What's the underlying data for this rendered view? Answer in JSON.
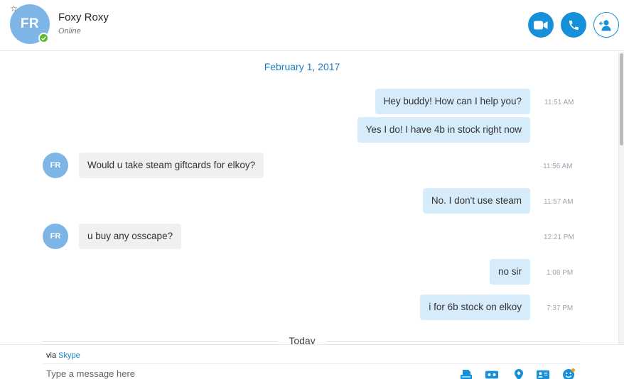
{
  "contact": {
    "initials": "FR",
    "name": "Foxy Roxy",
    "status": "Online"
  },
  "header_actions": [
    {
      "name": "video-call-button",
      "icon": "video-camera-icon"
    },
    {
      "name": "audio-call-button",
      "icon": "phone-icon"
    },
    {
      "name": "add-participant-button",
      "icon": "add-person-icon"
    }
  ],
  "conversation": {
    "date": "February 1, 2017",
    "today_label": "Today",
    "messages": [
      {
        "dir": "out",
        "text": "Hey buddy! How can I help you?",
        "time": "11:51 AM"
      },
      {
        "dir": "out",
        "text": "Yes I do! I have 4b in stock right now",
        "time": ""
      },
      {
        "dir": "in",
        "text": "Would u take steam giftcards for elkoy?",
        "time": "11:56 AM"
      },
      {
        "dir": "out",
        "text": "No. I don't use steam",
        "time": "11:57 AM"
      },
      {
        "dir": "in",
        "text": "u buy any osscape?",
        "time": "12:21 PM"
      },
      {
        "dir": "out",
        "text": "no sir",
        "time": "1:08 PM"
      },
      {
        "dir": "out",
        "text": "i for 6b stock on elkoy",
        "time": "7:37 PM"
      }
    ]
  },
  "composer": {
    "via_prefix": "via",
    "via_service": "Skype",
    "placeholder": "Type a message here",
    "tools": [
      "file-icon",
      "video-message-icon",
      "location-icon",
      "contact-card-icon",
      "emoticon-icon"
    ]
  },
  "colors": {
    "accent": "#1690d8",
    "avatar": "#7cb5e6",
    "outgoing_bubble": "#d7ecfb",
    "incoming_bubble": "#eef0f2",
    "online": "#5cb82e"
  }
}
